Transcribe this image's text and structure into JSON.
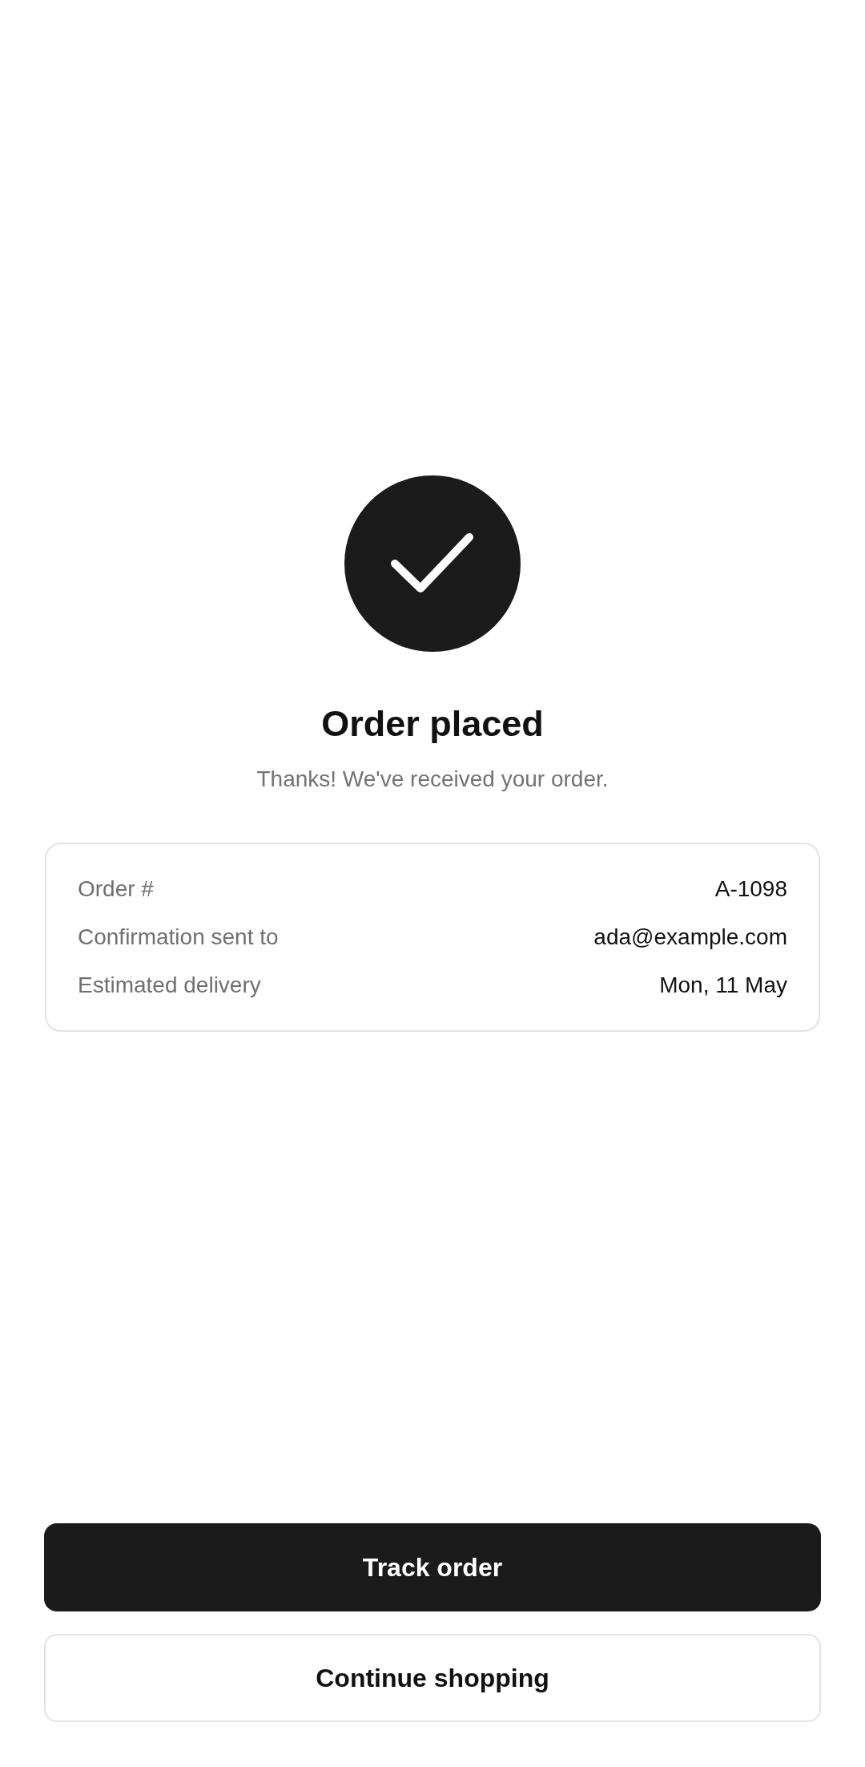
{
  "confirmation": {
    "title": "Order placed",
    "message": "Thanks! We've received your order."
  },
  "details": [
    {
      "label": "Order #",
      "value": "A-1098"
    },
    {
      "label": "Confirmation sent to",
      "value": "ada@example.com"
    },
    {
      "label": "Estimated delivery",
      "value": "Mon, 11 May"
    }
  ],
  "actions": [
    {
      "label": "Track order",
      "kind": "primary"
    },
    {
      "label": "Continue shopping",
      "kind": "secondary"
    }
  ]
}
